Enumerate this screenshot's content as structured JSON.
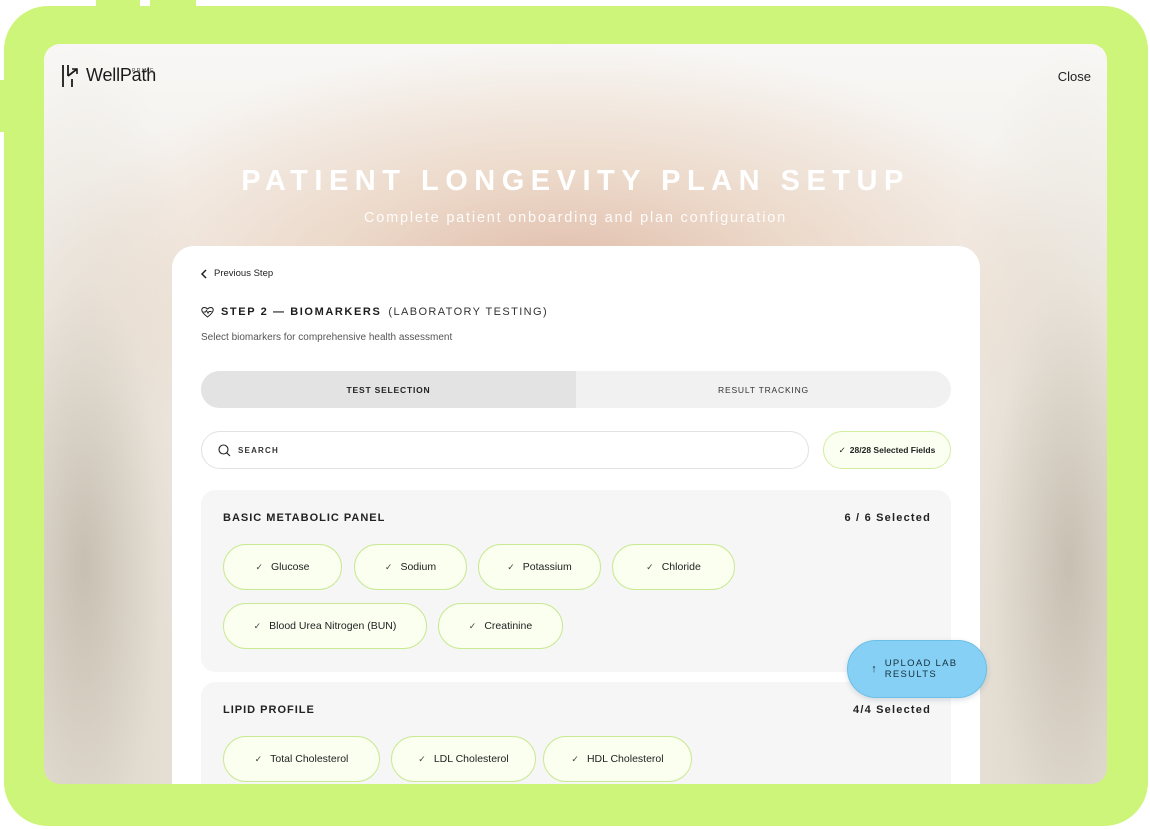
{
  "brand": {
    "name": "WellPath",
    "sub": "PRIME"
  },
  "header": {
    "close_label": "Close"
  },
  "page": {
    "title": "PATIENT LONGEVITY PLAN SETUP",
    "subtitle": "Complete patient onboarding and plan configuration"
  },
  "card": {
    "back_label": "Previous Step",
    "step_title": "STEP 2 — BIOMARKERS",
    "step_suffix": "(LABORATORY TESTING)",
    "step_description": "Select biomarkers for comprehensive health assessment",
    "tabs": [
      {
        "label": "TEST SELECTION",
        "active": true
      },
      {
        "label": "RESULT TRACKING",
        "active": false
      }
    ],
    "search": {
      "placeholder": "SEARCH",
      "value": ""
    },
    "selected_fields": "28/28 Selected Fields"
  },
  "panels": [
    {
      "title": "BASIC METABOLIC PANEL",
      "count": "6 / 6 Selected",
      "items": [
        "Glucose",
        "Sodium",
        "Potassium",
        "Chloride",
        "Blood Urea Nitrogen (BUN)",
        "Creatinine"
      ]
    },
    {
      "title": "LIPID PROFILE",
      "count": "4/4 Selected",
      "items": [
        "Total Cholesterol",
        "LDL Cholesterol",
        "HDL Cholesterol"
      ]
    }
  ],
  "upload_button": {
    "label": "UPLOAD LAB RESULTS"
  },
  "colors": {
    "frame": "#cdf57a",
    "chip_border": "#c9e993",
    "upload_button": "#86d0f5"
  },
  "icons": {
    "back": "chevron-left-icon",
    "step": "heart-pulse-icon",
    "search": "search-icon",
    "check": "check-icon",
    "upload": "arrow-up-icon"
  }
}
